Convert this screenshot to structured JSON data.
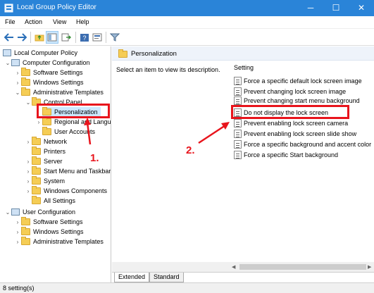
{
  "window": {
    "title": "Local Group Policy Editor"
  },
  "menu": [
    "File",
    "Action",
    "View",
    "Help"
  ],
  "tree": [
    {
      "label": "Local Computer Policy",
      "icon": "policy-icon"
    },
    {
      "label": "Computer Configuration",
      "icon": "computer-icon"
    },
    {
      "label": "Software Settings",
      "icon": "folder-icon"
    },
    {
      "label": "Windows Settings",
      "icon": "folder-icon"
    },
    {
      "label": "Administrative Templates",
      "icon": "folder-icon"
    },
    {
      "label": "Control Panel",
      "icon": "folder-icon"
    },
    {
      "label": "Personalization",
      "icon": "folder-icon"
    },
    {
      "label": "Regional and Language",
      "icon": "folder-icon"
    },
    {
      "label": "User Accounts",
      "icon": "folder-icon"
    },
    {
      "label": "Network",
      "icon": "folder-icon"
    },
    {
      "label": "Printers",
      "icon": "folder-icon"
    },
    {
      "label": "Server",
      "icon": "folder-icon"
    },
    {
      "label": "Start Menu and Taskbar",
      "icon": "folder-icon"
    },
    {
      "label": "System",
      "icon": "folder-icon"
    },
    {
      "label": "Windows Components",
      "icon": "folder-icon"
    },
    {
      "label": "All Settings",
      "icon": "folder-icon"
    },
    {
      "label": "User Configuration",
      "icon": "computer-icon"
    },
    {
      "label": "Software Settings",
      "icon": "folder-icon"
    },
    {
      "label": "Windows Settings",
      "icon": "folder-icon"
    },
    {
      "label": "Administrative Templates",
      "icon": "folder-icon"
    }
  ],
  "right": {
    "header": "Personalization",
    "description": "Select an item to view its description.",
    "column": "Setting",
    "settings": [
      "Force a specific default lock screen image",
      "Prevent changing lock screen image",
      "Prevent changing start menu background",
      "Do not display the lock screen",
      "Prevent enabling lock screen camera",
      "Prevent enabling lock screen slide show",
      "Force a specific background and accent color",
      "Force a specific Start background"
    ]
  },
  "tabs": [
    "Extended",
    "Standard"
  ],
  "status": "8 setting(s)",
  "annotations": {
    "step1": "1.",
    "step2": "2."
  },
  "colors": {
    "accent": "#2a84d8",
    "highlight": "#e8141c"
  }
}
